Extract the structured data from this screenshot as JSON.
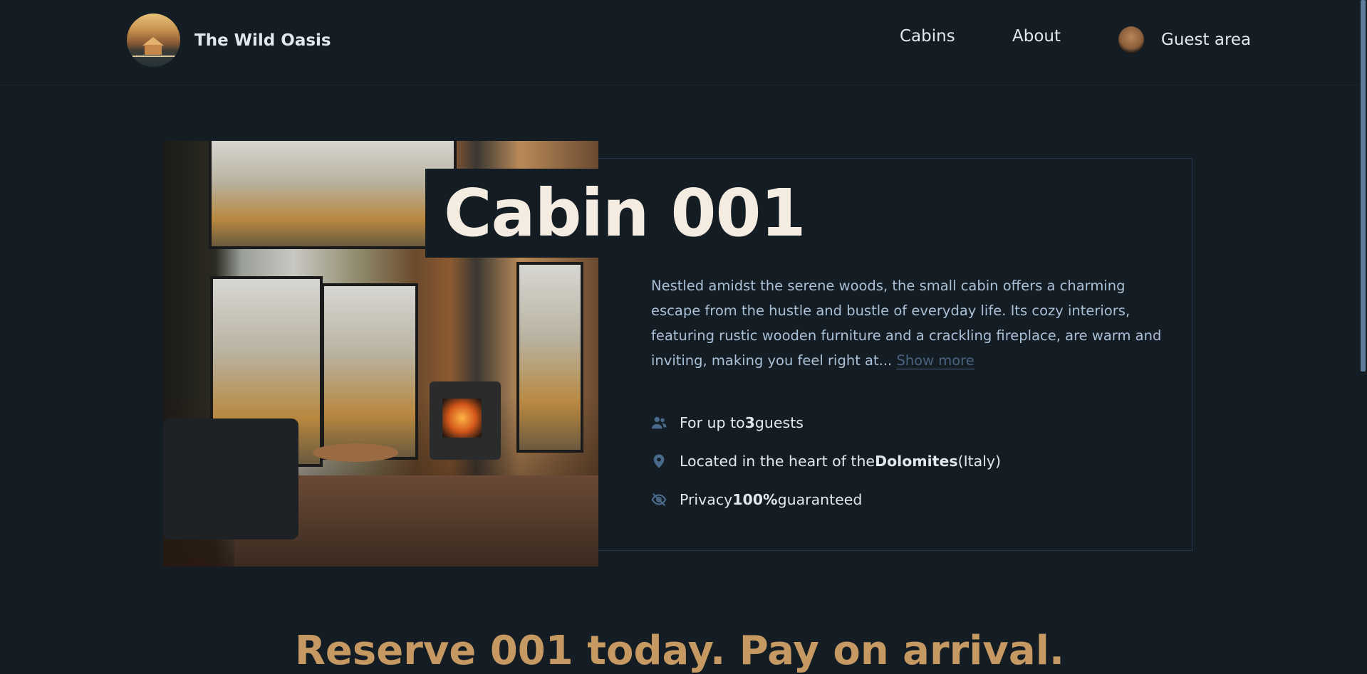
{
  "header": {
    "logo_text": "The Wild Oasis",
    "nav": [
      {
        "label": "Cabins"
      },
      {
        "label": "About"
      },
      {
        "label": "Guest area"
      }
    ]
  },
  "cabin": {
    "title": "Cabin 001",
    "description": "Nestled amidst the serene woods, the small cabin offers a charming escape from the hustle and bustle of everyday life. Its cozy interiors, featuring rustic wooden furniture and a crackling fireplace, are warm and inviting, making you feel right at...",
    "show_more": "Show more",
    "features": {
      "guests_pre": "For up to ",
      "guests_value": "3",
      "guests_post": " guests",
      "location_pre": "Located in the heart of the ",
      "location_value": "Dolomites",
      "location_post": " (Italy)",
      "privacy_pre": "Privacy ",
      "privacy_value": "100%",
      "privacy_post": " guaranteed"
    }
  },
  "reserve_heading": "Reserve 001 today. Pay on arrival.",
  "icons": {
    "guests": "users-icon",
    "location": "map-pin-icon",
    "privacy": "eye-slash-icon"
  },
  "colors": {
    "background": "#141c24",
    "accent": "#c69963",
    "icon": "#4a6a8c",
    "title": "#f4ece1"
  }
}
